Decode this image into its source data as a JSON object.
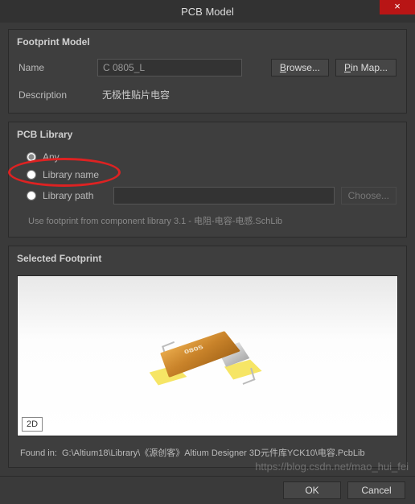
{
  "window": {
    "title": "PCB Model",
    "close_glyph": "×"
  },
  "footprint_model": {
    "section_title": "Footprint Model",
    "name_label": "Name",
    "name_value": "C 0805_L",
    "browse_label": "Browse...",
    "pinmap_label": "Pin Map...",
    "desc_label": "Description",
    "desc_value": "无极性贴片电容"
  },
  "pcb_library": {
    "section_title": "PCB Library",
    "options": {
      "any": "Any",
      "libname": "Library name",
      "libpath": "Library path"
    },
    "choose_label": "Choose...",
    "hint": "Use footprint from component library 3.1    - 电阻-电容-电感.SchLib"
  },
  "selected_footprint": {
    "section_title": "Selected Footprint",
    "mode": "2D",
    "marking": "0805"
  },
  "foundin": {
    "label": "Found in:",
    "path": "G:\\Altium18\\Library\\《源创客》Altium Designer 3D元件库YCK10\\电容.PcbLib"
  },
  "footer": {
    "ok": "OK",
    "cancel": "Cancel"
  },
  "watermark": "https://blog.csdn.net/mao_hui_fei"
}
